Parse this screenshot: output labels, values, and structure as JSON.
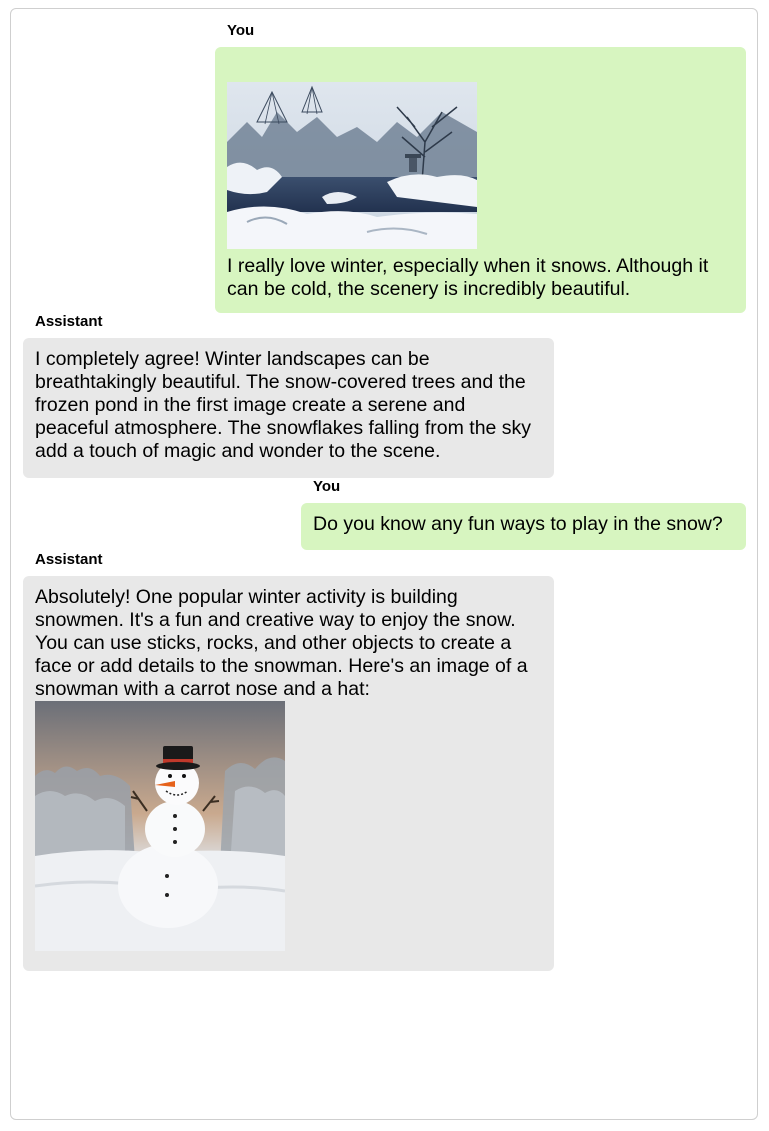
{
  "conversation": {
    "messages": [
      {
        "role": "You",
        "text": "I really love winter, especially when it snows. Although it can be cold, the scenery is incredibly beautiful.",
        "image": "winter-garden-pond-photo"
      },
      {
        "role": "Assistant",
        "text": "I completely agree! Winter landscapes can be breathtakingly beautiful. The snow-covered trees and the frozen pond in the first image create a serene and peaceful atmosphere. The snowflakes falling from the sky add a touch of magic and wonder to the scene."
      },
      {
        "role": "You",
        "text": "Do you know any fun ways to play in the snow?"
      },
      {
        "role": "Assistant",
        "text": "Absolutely! One popular winter activity is building snowmen. It's a fun and creative way to enjoy the snow. You can use sticks, rocks, and other objects to create a face or add details to the snowman. Here's an image of a snowman with a carrot nose and a hat:",
        "image": "snowman-photo"
      }
    ]
  },
  "colors": {
    "user_bubble": "#d7f5c0",
    "assistant_bubble": "#e8e8e8",
    "frame_border": "#cfcfcf"
  }
}
